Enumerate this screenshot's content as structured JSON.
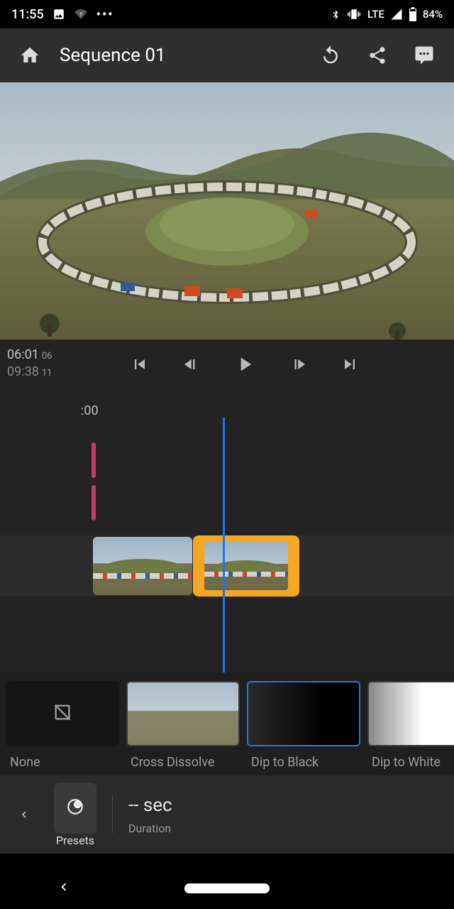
{
  "status": {
    "time": "11:55",
    "network_label": "LTE",
    "battery_text": "84%"
  },
  "appbar": {
    "title": "Sequence 01"
  },
  "transport": {
    "current_time": "06:01",
    "current_frames": "06",
    "total_time": "09:38",
    "total_frames": "11"
  },
  "timeline": {
    "ruler_label": ":00"
  },
  "transitions": {
    "items": [
      {
        "label": "None",
        "kind": "none",
        "selected": false
      },
      {
        "label": "Cross Dissolve",
        "kind": "cross",
        "selected": false
      },
      {
        "label": "Dip to Black",
        "kind": "black",
        "selected": true
      },
      {
        "label": "Dip to White",
        "kind": "white",
        "selected": false
      }
    ]
  },
  "panel": {
    "presets_label": "Presets",
    "duration_value": "-- sec",
    "duration_label": "Duration"
  },
  "colors": {
    "accent": "#2474e8",
    "clip_highlight": "#f5a623",
    "audio_marker": "#c33a6b"
  }
}
